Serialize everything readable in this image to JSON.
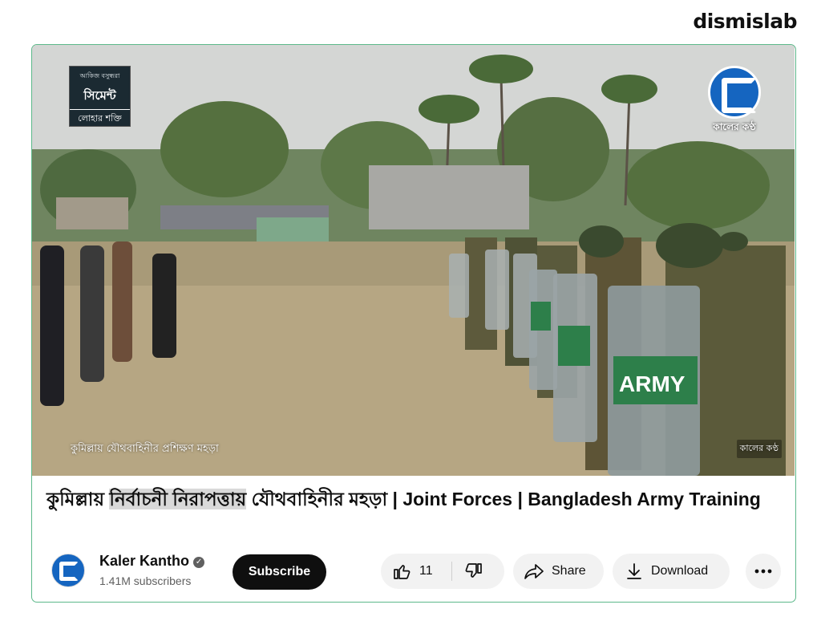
{
  "watermark": "dismislab",
  "video": {
    "top_left_logo": {
      "line1": "আকিজ বসুন্ধরা",
      "line2": "সিমেন্ট",
      "line3": "লোহার শক্তি"
    },
    "channel_logo_text": "কালের কণ্ঠ",
    "caption_left": "কুমিল্লায় যৌথবাহিনীর প্রশিক্ষণ মহড়া",
    "caption_right": "কালের কণ্ঠ",
    "shield_text": "ARMY"
  },
  "title": {
    "part1": "কুমিল্লায় ",
    "highlight": "নির্বাচনী নিরাপত্তায়",
    "part2": " যৌথবাহিনীর মহড়া | Joint Forces | Bangladesh Army Training"
  },
  "channel": {
    "name": "Kaler Kantho",
    "subscribers": "1.41M subscribers"
  },
  "actions": {
    "subscribe": "Subscribe",
    "like_count": "11",
    "share": "Share",
    "download": "Download"
  },
  "icons": [
    "thumbs-up-icon",
    "thumbs-down-icon",
    "share-icon",
    "download-icon",
    "more-icon",
    "verified-icon"
  ]
}
